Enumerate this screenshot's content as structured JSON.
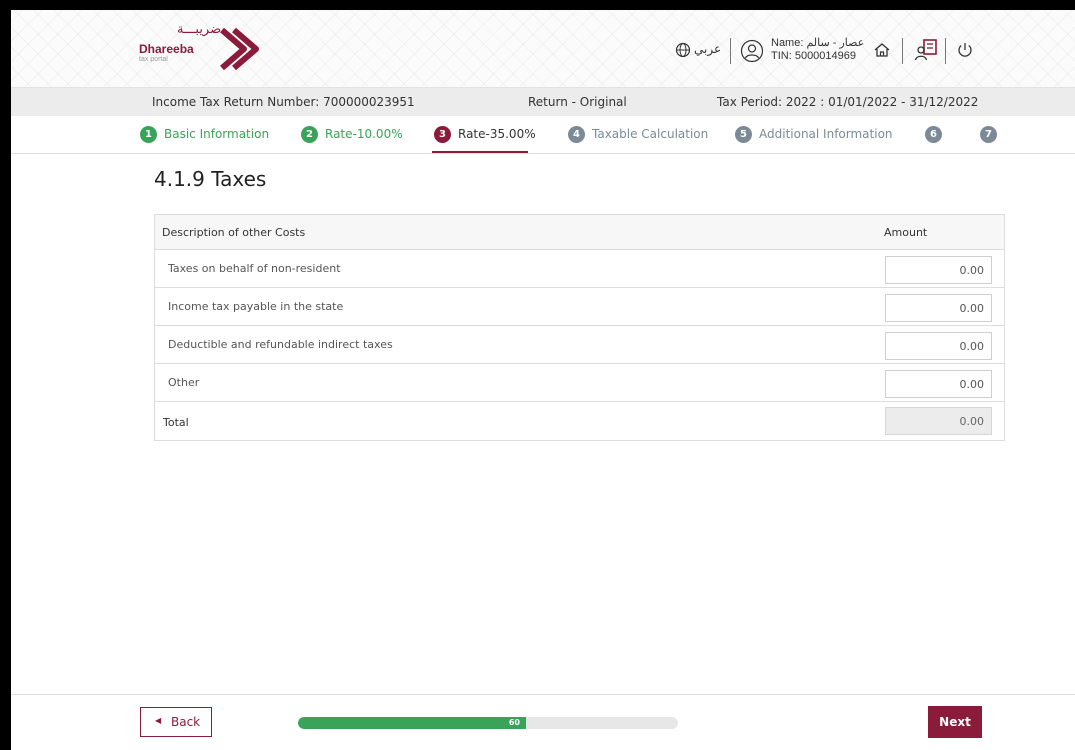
{
  "header": {
    "logo_arabic": "ضريبـــة",
    "logo_english": "Dhareeba",
    "logo_sub": "tax portal",
    "language_link": "عربي",
    "user_name": "Name: عصار - سالم",
    "user_tin": "TIN: 5000014969"
  },
  "info_bar": {
    "return_number": "Income Tax Return Number: 700000023951",
    "return_type": "Return - Original",
    "tax_period": "Tax Period: 2022 : 01/01/2022 - 31/12/2022"
  },
  "steps": [
    {
      "num": "1",
      "label": "Basic Information",
      "status": "done"
    },
    {
      "num": "2",
      "label": "Rate-10.00%",
      "status": "done"
    },
    {
      "num": "3",
      "label": "Rate-35.00%",
      "status": "active"
    },
    {
      "num": "4",
      "label": "Taxable Calculation",
      "status": "pending"
    },
    {
      "num": "5",
      "label": "Additional Information",
      "status": "pending"
    },
    {
      "num": "6",
      "label": "",
      "status": "pending"
    },
    {
      "num": "7",
      "label": "",
      "status": "pending"
    }
  ],
  "section_title": "4.1.9 Taxes",
  "table": {
    "col_description": "Description of other Costs",
    "col_amount": "Amount",
    "rows": [
      {
        "label": "Taxes on behalf of non-resident",
        "value": "0.00"
      },
      {
        "label": "Income tax payable in the state",
        "value": "0.00"
      },
      {
        "label": "Deductible and refundable indirect taxes",
        "value": "0.00"
      },
      {
        "label": "Other",
        "value": "0.00"
      }
    ],
    "total_label": "Total",
    "total_value": "0.00"
  },
  "footer": {
    "back_label": "Back",
    "progress_percent": 60,
    "progress_label": "60",
    "next_label": "Next"
  },
  "colors": {
    "brand": "#8b1b3a",
    "success": "#3aa35a",
    "pending": "#7b8a96"
  }
}
